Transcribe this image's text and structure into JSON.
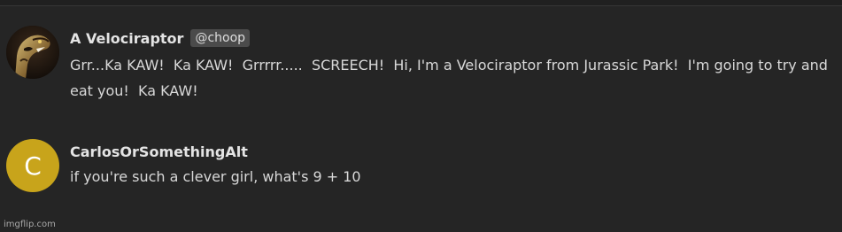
{
  "comments": [
    {
      "author": "A Velociraptor",
      "handle": "@choop",
      "text": "Grr...Ka KAW!  Ka KAW!  Grrrrr.....  SCREECH!  Hi, I'm a Velociraptor from Jurassic Park!  I'm going to try and eat you!  Ka KAW!",
      "avatar": "raptor-image"
    },
    {
      "author": "CarlosOrSomethingAlt",
      "text": "if you're such a clever girl, what's 9 + 10",
      "avatar_letter": "C",
      "avatar_color": "#c8a41b"
    }
  ],
  "watermark": "imgflip.com"
}
